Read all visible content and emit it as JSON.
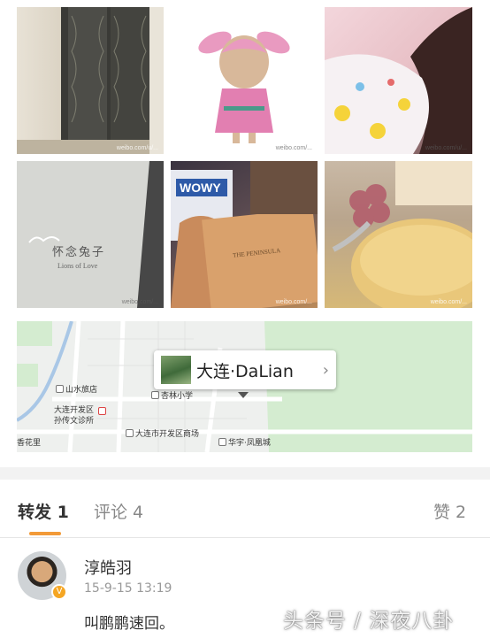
{
  "photos": [
    {
      "name": "photo-door",
      "watermark": "weibo.com/u/..."
    },
    {
      "name": "photo-bunny-figure",
      "watermark": "weibo.com/..."
    },
    {
      "name": "photo-sleeping-girl",
      "watermark": "weibo.com/u/..."
    },
    {
      "name": "photo-book-cover",
      "watermark": "weibo.com/..."
    },
    {
      "name": "photo-gift-box",
      "watermark": "weibo.com/..."
    },
    {
      "name": "photo-cake",
      "watermark": "weibo.com/..."
    }
  ],
  "book": {
    "title": "怀念兔子",
    "subtitle": "Lions of Love"
  },
  "gift_box": {
    "brand": "WOWY",
    "label": "THE PENINSULA"
  },
  "map": {
    "location": "大连·DaLian",
    "labels": {
      "inn": "山水旅店",
      "school": "杏林小学",
      "clinic_1": "大连开发区",
      "clinic_2": "孙传文诊所",
      "garden": "香花里",
      "mall": "大连市开发区商场",
      "city": "华宇·凤凰城"
    }
  },
  "tabs": {
    "repost": "转发 1",
    "comment": "评论 4",
    "like": "赞 2"
  },
  "comment": {
    "user": "淳皓羽",
    "time": "15-9-15 13:19",
    "text": "叫鹏鹏速回。",
    "badge": "V"
  },
  "watermark_overlay": "头条号 / 深夜八卦",
  "colors": {
    "accent": "#f29a38",
    "map_green": "#d4ecd0"
  }
}
